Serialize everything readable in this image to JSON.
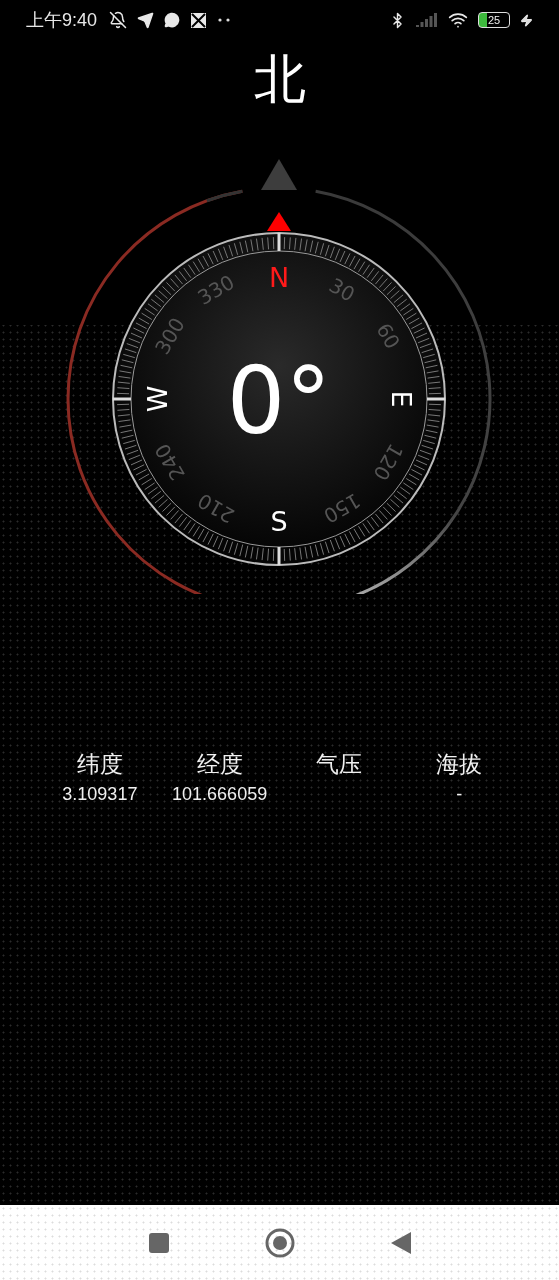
{
  "status_bar": {
    "time": "上午9:40",
    "battery": "25"
  },
  "heading": "北",
  "compass": {
    "degrees": "0°",
    "dial_labels": [
      {
        "text": "N",
        "kind": "cardinal",
        "color": "#ff1a1a"
      },
      {
        "text": "30",
        "kind": "degree"
      },
      {
        "text": "60",
        "kind": "degree"
      },
      {
        "text": "E",
        "kind": "cardinal",
        "color": "#ffffff"
      },
      {
        "text": "120",
        "kind": "degree"
      },
      {
        "text": "150",
        "kind": "degree"
      },
      {
        "text": "S",
        "kind": "cardinal",
        "color": "#ffffff"
      },
      {
        "text": "210",
        "kind": "degree"
      },
      {
        "text": "240",
        "kind": "degree"
      },
      {
        "text": "W",
        "kind": "cardinal",
        "color": "#ffffff"
      },
      {
        "text": "300",
        "kind": "degree"
      },
      {
        "text": "330",
        "kind": "degree"
      }
    ]
  },
  "readings": [
    {
      "label": "纬度",
      "value": "3.109317"
    },
    {
      "label": "经度",
      "value": "101.666059"
    },
    {
      "label": "气压"
    },
    {
      "label": "海拔",
      "value": "-"
    }
  ]
}
